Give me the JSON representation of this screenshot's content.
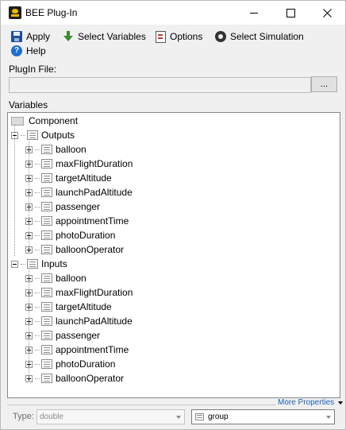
{
  "window": {
    "title": "BEE Plug-In"
  },
  "toolbar": {
    "apply": "Apply",
    "select_variables": "Select Variables",
    "options": "Options",
    "select_simulation": "Select Simulation",
    "help": "Help"
  },
  "plugin_file": {
    "label": "PlugIn File:",
    "value": "",
    "browse": "..."
  },
  "variables": {
    "label": "Variables",
    "root": "Component",
    "groups": [
      {
        "name": "Outputs",
        "items": [
          "balloon",
          "maxFlightDuration",
          "targetAltitude",
          "launchPadAltitude",
          "passenger",
          "appointmentTime",
          "photoDuration",
          "balloonOperator"
        ]
      },
      {
        "name": "Inputs",
        "items": [
          "balloon",
          "maxFlightDuration",
          "targetAltitude",
          "launchPadAltitude",
          "passenger",
          "appointmentTime",
          "photoDuration",
          "balloonOperator"
        ]
      }
    ]
  },
  "more_properties": "More Properties",
  "type_field": {
    "label": "Type:",
    "value": "double"
  },
  "group_field": {
    "value": "group"
  }
}
